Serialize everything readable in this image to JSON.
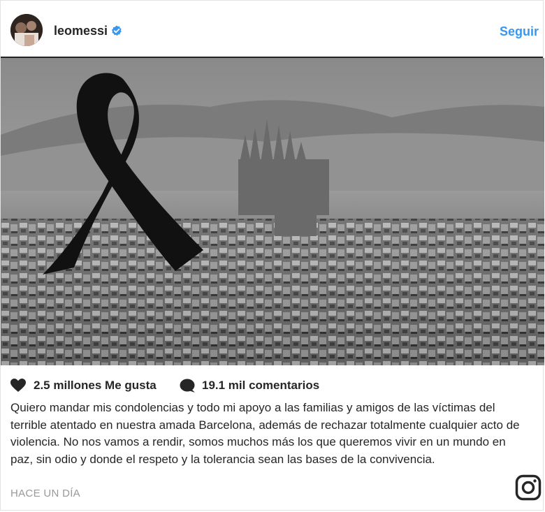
{
  "header": {
    "username": "leomessi",
    "follow_label": "Seguir"
  },
  "post": {
    "likes": "2.5 millones Me gusta",
    "comments": "19.1 mil comentarios",
    "caption": "Quiero mandar mis condolencias y todo mi apoyo a las familias y amigos de las víctimas del terrible atentado en nuestra amada Barcelona, además de rechazar totalmente cualquier acto de violencia. No nos vamos a rendir, somos muchos más los que queremos vivir en un mundo en paz, sin odio y donde el respeto y la tolerancia sean las bases de la convivencia.",
    "timestamp": "HACE UN DÍA"
  },
  "icons": {
    "verified": "verified-badge-icon",
    "like": "heart-icon",
    "comment": "comment-bubble-icon",
    "brand": "instagram-logo-icon"
  },
  "colors": {
    "accent": "#3897f0",
    "text": "#262626",
    "muted": "#999999"
  }
}
